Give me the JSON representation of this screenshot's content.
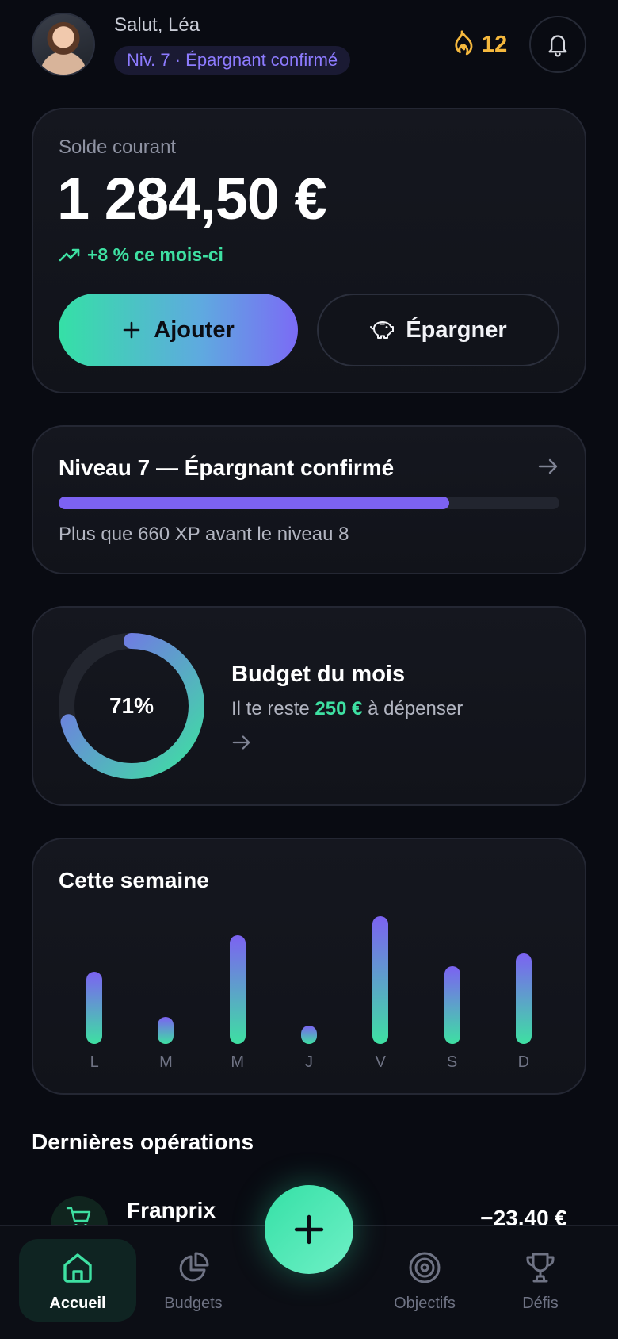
{
  "header": {
    "greeting": "Salut, Léa",
    "level_badge": "Niv. 7 · Épargnant confirmé",
    "streak_value": "12",
    "icons": {
      "streak": "flame-icon",
      "notifications": "bell-icon"
    }
  },
  "balance": {
    "label": "Solde courant",
    "value": "1 284,50 €",
    "trend": "+8 % ce mois-ci",
    "add_label": "Ajouter",
    "save_label": "Épargner"
  },
  "level": {
    "title": "Niveau 7 — Épargnant confirmé",
    "progress_fraction": 0.78,
    "subtitle": "Plus que 660 XP avant le niveau 8"
  },
  "budget": {
    "percent_label": "71%",
    "percent_value": 0.71,
    "title": "Budget du mois",
    "remaining_prefix": "Il te reste",
    "remaining_amount": "250 €",
    "remaining_suffix": "à dépenser"
  },
  "chart_data": {
    "type": "bar",
    "title": "Cette semaine",
    "categories": [
      "L",
      "M",
      "M",
      "J",
      "V",
      "S",
      "D"
    ],
    "values": [
      58,
      22,
      88,
      15,
      103,
      63,
      73
    ],
    "ylim": [
      0,
      105
    ],
    "grid": false
  },
  "operations": {
    "title": "Dernières opérations",
    "items": [
      {
        "name": "Franprix",
        "amount": "−23,40 €",
        "icon": "cart-icon"
      }
    ]
  },
  "nav": {
    "items": [
      {
        "label": "Accueil",
        "icon": "home-icon",
        "active": true
      },
      {
        "label": "Budgets",
        "icon": "pie-chart-icon",
        "active": false
      },
      {
        "label": "Objectifs",
        "icon": "target-icon",
        "active": false
      },
      {
        "label": "Défis",
        "icon": "trophy-icon",
        "active": false
      }
    ],
    "fab_icon": "plus-icon"
  },
  "colors": {
    "background": "#090b12",
    "accent_green": "#3ee0a2",
    "accent_purple": "#7c62f2",
    "streak": "#f5b83d"
  }
}
